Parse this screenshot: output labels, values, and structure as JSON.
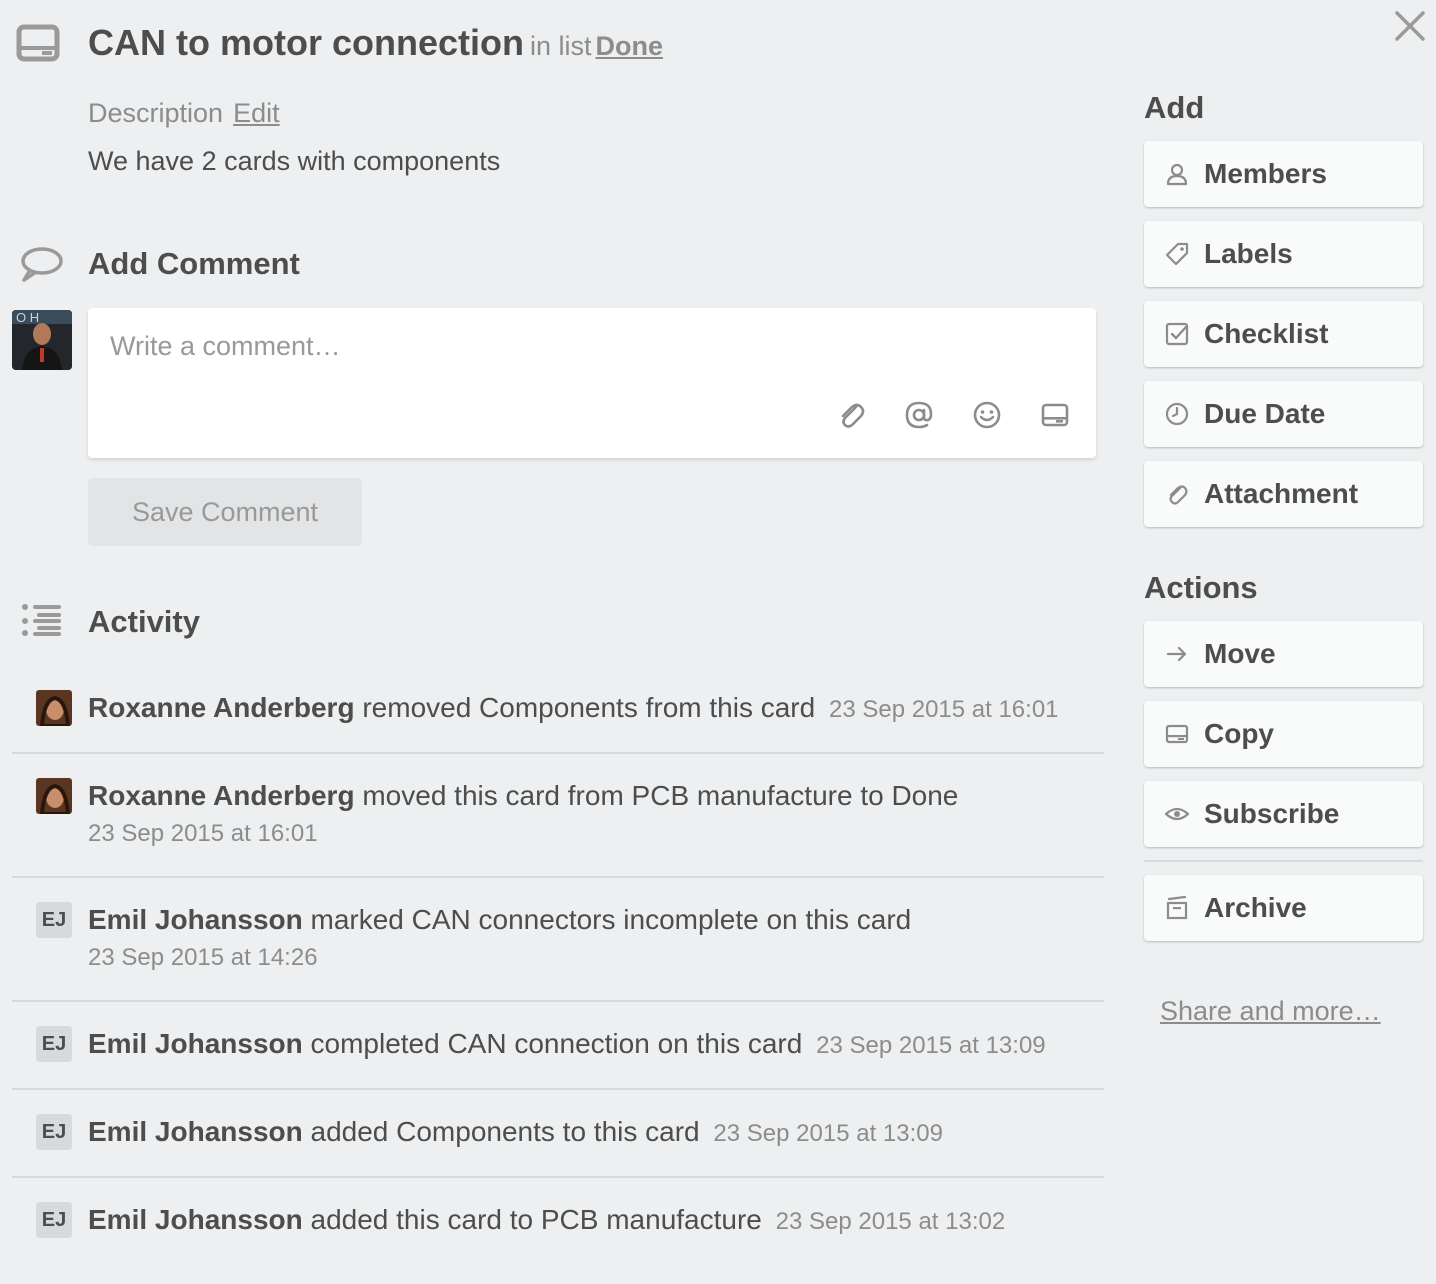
{
  "card": {
    "title": "CAN to motor connection",
    "in_list_prefix": "in list",
    "list_name": "Done"
  },
  "description": {
    "label": "Description",
    "edit_label": "Edit",
    "text": "We have 2 cards with components"
  },
  "comment": {
    "heading": "Add Comment",
    "placeholder": "Write a comment…",
    "save_label": "Save Comment"
  },
  "activity": {
    "heading": "Activity",
    "items": [
      {
        "name": "Roxanne Anderberg",
        "text": "removed Components from this card",
        "date": "23 Sep 2015 at 16:01",
        "initials": ""
      },
      {
        "name": "Roxanne Anderberg",
        "text": "moved this card from PCB manufacture to Done",
        "date": "23 Sep 2015 at 16:01",
        "initials": ""
      },
      {
        "name": "Emil Johansson",
        "text": "marked CAN connectors incomplete on this card",
        "date": "23 Sep 2015 at 14:26",
        "initials": "EJ"
      },
      {
        "name": "Emil Johansson",
        "text": "completed CAN connection on this card",
        "date": "23 Sep 2015 at 13:09",
        "initials": "EJ"
      },
      {
        "name": "Emil Johansson",
        "text": "added Components to this card",
        "date": "23 Sep 2015 at 13:09",
        "initials": "EJ"
      },
      {
        "name": "Emil Johansson",
        "text": "added this card to PCB manufacture",
        "date": "23 Sep 2015 at 13:02",
        "initials": "EJ"
      }
    ]
  },
  "sidebar": {
    "add_heading": "Add",
    "add_buttons": [
      {
        "label": "Members",
        "icon": "person-icon"
      },
      {
        "label": "Labels",
        "icon": "tag-icon"
      },
      {
        "label": "Checklist",
        "icon": "checkbox-icon"
      },
      {
        "label": "Due Date",
        "icon": "clock-icon"
      },
      {
        "label": "Attachment",
        "icon": "paperclip-icon"
      }
    ],
    "actions_heading": "Actions",
    "action_buttons": [
      {
        "label": "Move",
        "icon": "arrow-right-icon"
      },
      {
        "label": "Copy",
        "icon": "card-icon"
      },
      {
        "label": "Subscribe",
        "icon": "eye-icon"
      },
      {
        "label": "Archive",
        "icon": "archive-icon"
      }
    ],
    "share_label": "Share and more…"
  },
  "colors": {
    "background": "#edeff0",
    "text": "#4d4d4d",
    "muted": "#8c8c8c",
    "button_bg": "#f9fafa"
  }
}
